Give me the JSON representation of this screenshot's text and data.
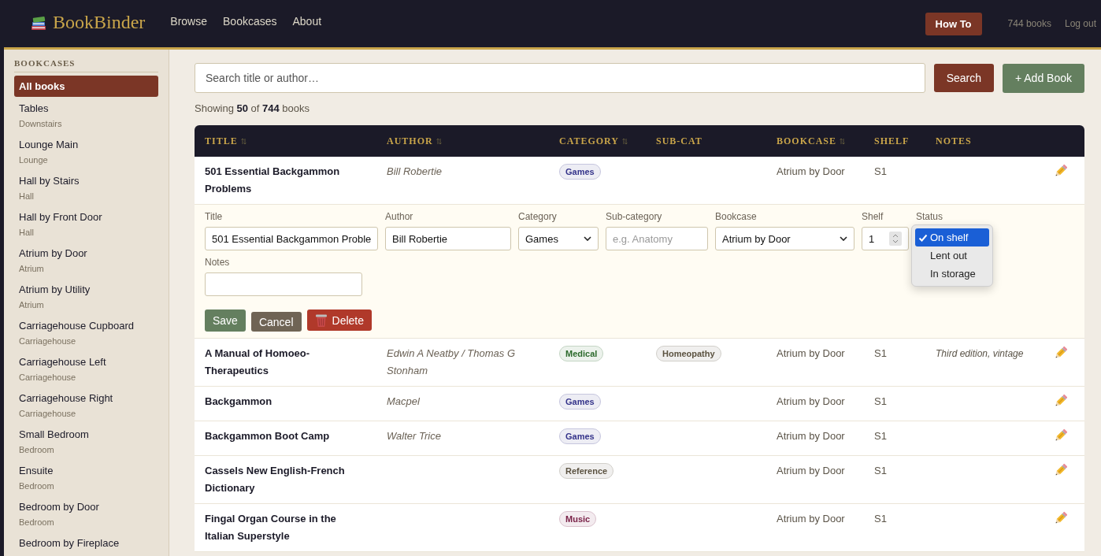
{
  "header": {
    "logo": "BookBinder",
    "nav": [
      {
        "label": "Browse"
      },
      {
        "label": "Bookcases"
      },
      {
        "label": "About"
      }
    ],
    "how_to_button": "How To",
    "book_count": "744 books",
    "logout": "Log out"
  },
  "sidebar": {
    "heading": "BOOKCASES",
    "items": [
      {
        "name": "All books",
        "selected": true
      },
      {
        "name": "Tables",
        "location": "Downstairs",
        "selected": false
      },
      {
        "name": "Lounge Main",
        "location": "Lounge",
        "selected": false
      },
      {
        "name": "Hall by Stairs",
        "location": "Hall",
        "selected": false
      },
      {
        "name": "Hall by Front Door",
        "location": "Hall",
        "selected": false
      },
      {
        "name": "Atrium by Door",
        "location": "Atrium",
        "selected": false
      },
      {
        "name": "Atrium by Utility",
        "location": "Atrium",
        "selected": false
      },
      {
        "name": "Carriagehouse Cupboard",
        "location": "Carriagehouse",
        "selected": false
      },
      {
        "name": "Carriagehouse Left",
        "location": "Carriagehouse",
        "selected": false
      },
      {
        "name": "Carriagehouse Right",
        "location": "Carriagehouse",
        "selected": false
      },
      {
        "name": "Small Bedroom",
        "location": "Bedroom",
        "selected": false
      },
      {
        "name": "Ensuite",
        "location": "Bedroom",
        "selected": false
      },
      {
        "name": "Bedroom by Door",
        "location": "Bedroom",
        "selected": false
      },
      {
        "name": "Bedroom by Fireplace",
        "selected": false
      }
    ]
  },
  "search": {
    "placeholder": "Search title or author…",
    "button": "Search",
    "add_button": "+ Add Book"
  },
  "summary": "Showing **50** of **744** books",
  "table": {
    "columns": [
      {
        "label": "TITLE",
        "sortable": true
      },
      {
        "label": "AUTHOR",
        "sortable": true
      },
      {
        "label": "CATEGORY",
        "sortable": true
      },
      {
        "label": "SUB-CAT",
        "sortable": false
      },
      {
        "label": "BOOKCASE",
        "sortable": true
      },
      {
        "label": "SHELF",
        "sortable": false
      },
      {
        "label": "NOTES",
        "sortable": false
      }
    ],
    "rows": [
      {
        "title": "501 Essential Backgammon Problems",
        "author": "Bill Robertie",
        "category": {
          "label": "Games",
          "color": "#34338a"
        },
        "bookcase": "Atrium by Door",
        "shelf": "S1",
        "edit_form": {
          "fields": [
            {
              "label": "Title",
              "kind": "text",
              "value": "501 Essential Backgammon Proble"
            },
            {
              "label": "Author",
              "kind": "text",
              "value": "Bill Robertie"
            },
            {
              "label": "Category",
              "kind": "select",
              "value": "Games"
            },
            {
              "label": "Sub-category",
              "kind": "text",
              "placeholder": "e.g. Anatomy"
            },
            {
              "label": "Bookcase",
              "kind": "select",
              "value": "Atrium by Door"
            },
            {
              "label": "Shelf",
              "kind": "number",
              "value": "1"
            },
            {
              "label": "Status",
              "kind": "menu",
              "options": [
                {
                  "label": "On shelf",
                  "selected": true
                },
                {
                  "label": "Lent out",
                  "selected": false
                },
                {
                  "label": "In storage",
                  "selected": false
                }
              ]
            },
            {
              "label": "Notes",
              "kind": "text"
            }
          ],
          "buttons": [
            {
              "label": "Save",
              "kind": "save"
            },
            {
              "label": "Cancel",
              "kind": "cancel"
            },
            {
              "label": "Delete",
              "kind": "delete"
            }
          ]
        }
      },
      {
        "title": "A Manual of Homoeo-Therapeutics",
        "author": "Edwin A Neatby / Thomas G Stonham",
        "category": {
          "label": "Medical",
          "color": "#2c6a2c"
        },
        "subcategory": {
          "label": "Homeopathy",
          "color": "#5b5240"
        },
        "bookcase": "Atrium by Door",
        "shelf": "S1",
        "notes": "Third edition, vintage"
      },
      {
        "title": "Backgammon",
        "author": "Macpel",
        "category": {
          "label": "Games",
          "color": "#34338a"
        },
        "bookcase": "Atrium by Door",
        "shelf": "S1"
      },
      {
        "title": "Backgammon Boot Camp",
        "author": "Walter Trice",
        "category": {
          "label": "Games",
          "color": "#34338a"
        },
        "bookcase": "Atrium by Door",
        "shelf": "S1"
      },
      {
        "title": "Cassels New English-French Dictionary",
        "category": {
          "label": "Reference",
          "color": "#5b5240"
        },
        "bookcase": "Atrium by Door",
        "shelf": "S1"
      },
      {
        "title": "Fingal Organ Course in the Italian Superstyle",
        "category": {
          "label": "Music",
          "color": "#7a2248"
        },
        "bookcase": "Atrium by Door",
        "shelf": "S1"
      }
    ]
  }
}
